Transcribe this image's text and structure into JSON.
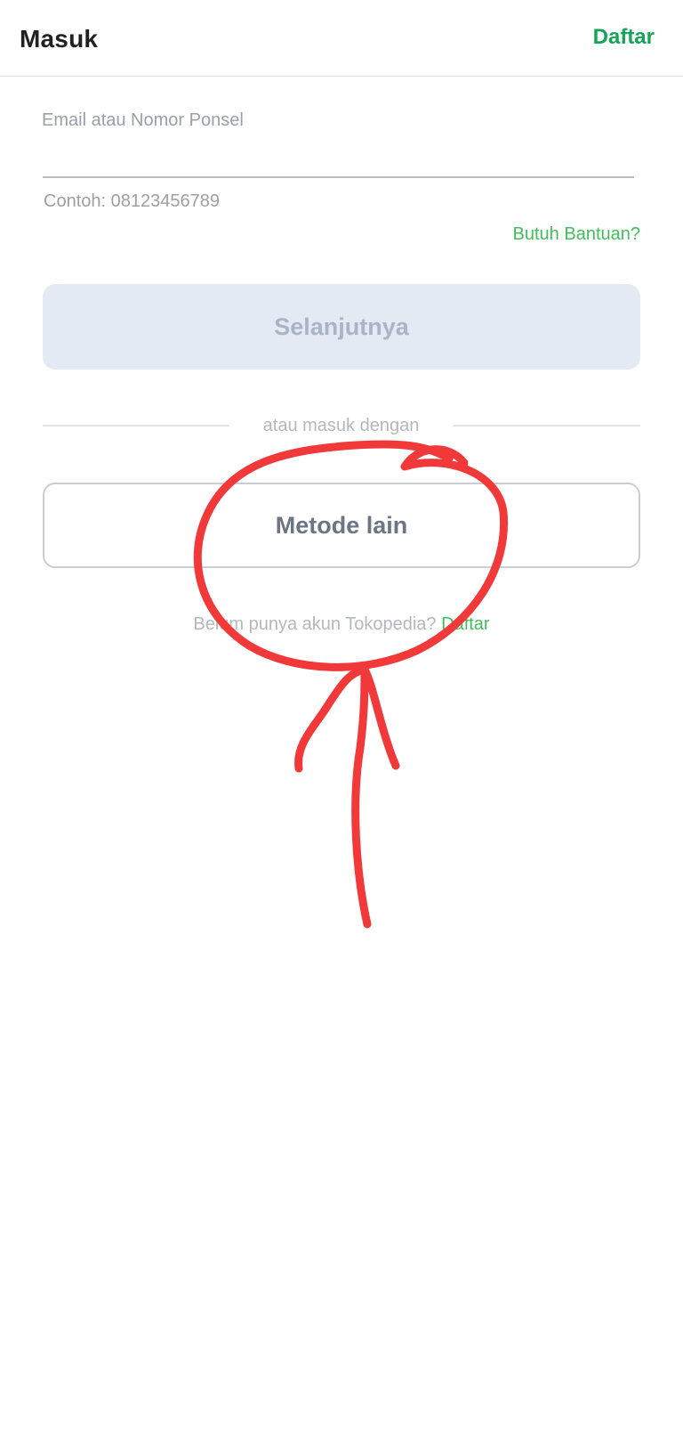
{
  "header": {
    "title": "Masuk",
    "register_label": "Daftar"
  },
  "login_form": {
    "input_label": "Email atau Nomor Ponsel",
    "input_value": "",
    "hint": "Contoh: 08123456789",
    "help_link": "Butuh Bantuan?",
    "next_button": "Selanjutnya"
  },
  "alternative": {
    "divider_text": "atau masuk dengan",
    "other_method_button": "Metode lain"
  },
  "footer": {
    "question": "Belum punya akun Tokopedia?",
    "register_link": "Daftar"
  },
  "colors": {
    "brand_green": "#16a35a",
    "link_green": "#3fbf5a",
    "annotation_red": "#f2393a"
  }
}
